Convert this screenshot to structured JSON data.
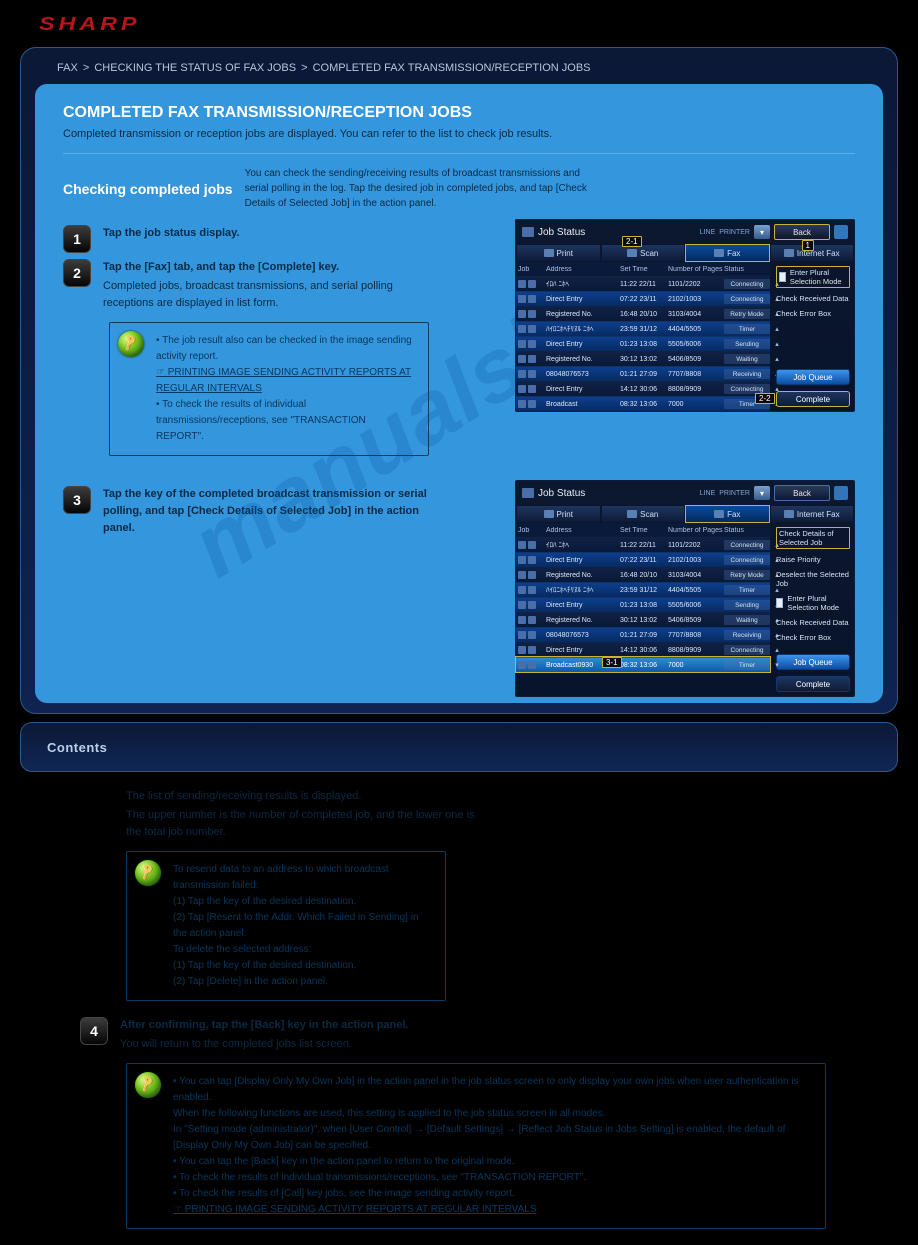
{
  "logo": "SHARP",
  "crumbs": [
    "FAX",
    "CHECKING THE STATUS OF FAX JOBS",
    "COMPLETED FAX TRANSMISSION/RECEPTION JOBS"
  ],
  "card": {
    "title": "COMPLETED FAX TRANSMISSION/RECEPTION JOBS",
    "sub": "Completed transmission or reception jobs are displayed. You can refer to the list to check job results."
  },
  "section": {
    "head": "Checking completed jobs",
    "sub": "You can check the sending/receiving results of broadcast transmissions and serial polling in the log. Tap the desired job in completed jobs, and tap [Check Details of Selected Job] in the action panel."
  },
  "steps": {
    "s1": {
      "lead": "Tap the job status display."
    },
    "s2": {
      "lead": "Tap the [Fax] tab, and tap the [Complete] key.",
      "sub": "Completed jobs, broadcast transmissions, and serial polling receptions are displayed in list form.",
      "callout_2_1": "2-1",
      "callout_2_2": "2-2"
    },
    "note1_lines": [
      "• The job result also can be checked in the image sending activity report.",
      "☞ PRINTING IMAGE SENDING ACTIVITY REPORTS AT REGULAR INTERVALS",
      "• To check the results of individual transmissions/receptions, see \"TRANSACTION REPORT\"."
    ],
    "s3": {
      "lead": "Tap the key of the completed broadcast transmission or serial polling, and tap [Check Details of Selected Job] in the action panel.",
      "sub1": "The list of sending/receiving results is displayed.",
      "sub2": "The upper number is the number of completed job, and the lower one is the total job number.",
      "callout_3_1": "3-1"
    },
    "note2_lines": [
      "To resend data to an address to which broadcast transmission failed:",
      "(1) Tap the key of the desired destination.",
      "(2) Tap [Resent to the Addr. Which Failed in Sending] in the action panel.",
      "To delete the selected address:",
      "(1) Tap the key of the desired destination.",
      "(2) Tap [Delete] in the action panel."
    ],
    "s4": {
      "lead": "After confirming, tap the [Back] key in the action panel.",
      "sub": "You will return to the completed jobs list screen."
    },
    "note3_lines": [
      "• You can tap [Display Only My Own Job] in the action panel in the job status screen to only display your own jobs when user authentication is enabled.",
      "When the following functions are used, this setting is applied to the job status screen in all modes.",
      "In \"Setting mode (administrator)\", when [User Control] → [Default Settings] → [Reflect Job Status in Jobs Setting] is enabled, the default of [Display Only My Own Job] can be specified.",
      "• You can tap the [Back] key in the action panel to return to the original mode.",
      "• To check the results of individual transmissions/receptions, see \"TRANSACTION REPORT\".",
      "• To check the results of [Call] key jobs, see the image sending activity report.",
      "☞ PRINTING IMAGE SENDING ACTIVITY REPORTS AT REGULAR INTERVALS"
    ]
  },
  "shot": {
    "title": "Job Status",
    "back": "Back",
    "tabs": [
      "Print",
      "Scan",
      "Fax",
      "Internet Fax"
    ],
    "headers": [
      "Job",
      "Address",
      "Set Time",
      "Number of Pages",
      "Status"
    ],
    "aside": {
      "selmode": "Enter Plural Selection Mode",
      "recv": "Check Received Data",
      "errbox": "Check Error Box",
      "details": "Check Details of Selected Job",
      "raise": "Raise Priority",
      "deselect": "Deselect the Selected Job"
    },
    "btns": {
      "queue": "Job Queue",
      "complete": "Complete"
    },
    "rows": [
      {
        "addr": "ｲﾛﾊ ﾆﾎﾍ",
        "time": "11:22 22/11",
        "pages": "1101/2202",
        "status": "Connecting"
      },
      {
        "addr": "Direct Entry",
        "time": "07:22 23/11",
        "pages": "2102/1003",
        "status": "Connecting"
      },
      {
        "addr": "Registered No.",
        "time": "16:48 20/10",
        "pages": "3103/4004",
        "status": "Retry Mode"
      },
      {
        "addr": "ﾊｲﾛﾆﾎﾍﾁﾘﾇﾙ ﾆﾎﾍ",
        "time": "23:59 31/12",
        "pages": "4404/5505",
        "status": "Timer"
      },
      {
        "addr": "Direct Entry",
        "time": "01:23 13:08",
        "pages": "5505/6006",
        "status": "Sending"
      },
      {
        "addr": "Registered No.",
        "time": "30:12 13:02",
        "pages": "5406/8509",
        "status": "Waiting"
      },
      {
        "addr": "08048076573",
        "time": "01:21 27:09",
        "pages": "7707/8808",
        "status": "Receiving"
      },
      {
        "addr": "Direct Entry",
        "time": "14:12 30:06",
        "pages": "8808/9909",
        "status": "Connecting"
      },
      {
        "addr": "Broadcast",
        "time": "08:32 13:06",
        "pages": "7000",
        "status": "Timer"
      }
    ],
    "selected_row": {
      "addr": "Broadcast0930",
      "time": "08:32 13:06",
      "pages": "7000",
      "status": "Timer"
    },
    "hud": {
      "line": "LINE",
      "printer": "PRINTER"
    },
    "callouts": {
      "c1": "1"
    }
  },
  "toc": "Contents",
  "watermark": "manualshve.c"
}
